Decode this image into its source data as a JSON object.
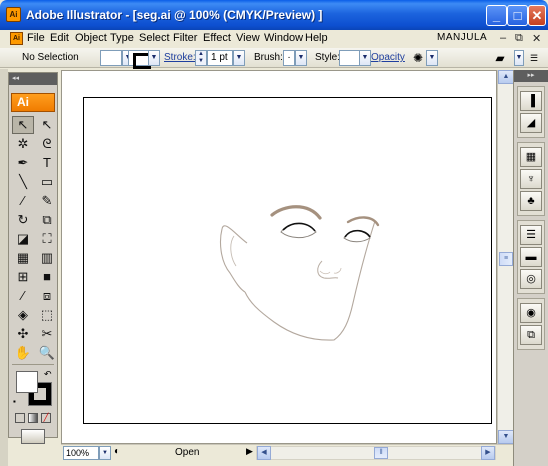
{
  "window": {
    "app_icon_text": "Ai",
    "title": "Adobe Illustrator - [seg.ai @ 100% (CMYK/Preview) ]",
    "minimize": "_",
    "maximize": "□",
    "close": "✕"
  },
  "menubar": {
    "doc_icon_text": "Ai",
    "items": [
      "File",
      "Edit",
      "Object",
      "Type",
      "Select",
      "Filter",
      "Effect",
      "View",
      "Window",
      "Help"
    ],
    "workspace": "MANJULA",
    "doc_minimize": "–",
    "doc_restore": "⧉",
    "doc_close": "✕"
  },
  "controlbar": {
    "selection": "No Selection",
    "stroke_label": "Stroke:",
    "stroke_weight": "1 pt",
    "brush_label": "Brush:",
    "brush_value": "·",
    "style_label": "Style:",
    "opacity_label": "Opacity"
  },
  "tools_panel": {
    "logo": "Ai",
    "collapse": "◂◂",
    "tools": [
      {
        "name": "selection-tool",
        "glyph": "↖"
      },
      {
        "name": "direct-selection-tool",
        "glyph": "↖"
      },
      {
        "name": "magic-wand-tool",
        "glyph": "✲"
      },
      {
        "name": "lasso-tool",
        "glyph": "ᘓ"
      },
      {
        "name": "pen-tool",
        "glyph": "✒"
      },
      {
        "name": "type-tool",
        "glyph": "T"
      },
      {
        "name": "line-segment-tool",
        "glyph": "╲"
      },
      {
        "name": "rectangle-tool",
        "glyph": "▭"
      },
      {
        "name": "paintbrush-tool",
        "glyph": "∕"
      },
      {
        "name": "pencil-tool",
        "glyph": "✎"
      },
      {
        "name": "rotate-tool",
        "glyph": "↻"
      },
      {
        "name": "scale-tool",
        "glyph": "⧉"
      },
      {
        "name": "warp-tool",
        "glyph": "◪"
      },
      {
        "name": "free-transform-tool",
        "glyph": "⛶"
      },
      {
        "name": "symbol-sprayer-tool",
        "glyph": "▦"
      },
      {
        "name": "column-graph-tool",
        "glyph": "▥"
      },
      {
        "name": "mesh-tool",
        "glyph": "⊞"
      },
      {
        "name": "gradient-tool",
        "glyph": "■"
      },
      {
        "name": "eyedropper-tool",
        "glyph": "⁄"
      },
      {
        "name": "blend-tool",
        "glyph": "⧈"
      },
      {
        "name": "live-paint-bucket-tool",
        "glyph": "◈"
      },
      {
        "name": "live-paint-selection-tool",
        "glyph": "⬚"
      },
      {
        "name": "slice-tool",
        "glyph": "✣"
      },
      {
        "name": "scissors-tool",
        "glyph": "✂"
      },
      {
        "name": "hand-tool",
        "glyph": "✋"
      },
      {
        "name": "zoom-tool",
        "glyph": "🔍"
      }
    ],
    "swap": "↶",
    "default_colors": "▪"
  },
  "statusbar": {
    "zoom": "100%",
    "status": "Open"
  },
  "dock": {
    "collapse": "▸▸",
    "groups": [
      [
        "color-panel-icon",
        "color-guide-icon"
      ],
      [
        "swatches-panel-icon",
        "brushes-panel-icon",
        "symbols-panel-icon"
      ],
      [
        "stroke-panel-icon",
        "gradient-panel-icon",
        "transparency-panel-icon"
      ],
      [
        "appearance-panel-icon",
        "layers-panel-icon"
      ]
    ],
    "glyphs": {
      "color-panel-icon": "▐",
      "color-guide-icon": "◢",
      "swatches-panel-icon": "▦",
      "brushes-panel-icon": "♆",
      "symbols-panel-icon": "♣",
      "stroke-panel-icon": "☰",
      "gradient-panel-icon": "▬",
      "transparency-panel-icon": "◎",
      "appearance-panel-icon": "◉",
      "layers-panel-icon": "⧉"
    }
  },
  "colors": {
    "accent": "#0a5ee8",
    "logo_orange": "#f07c00",
    "eyebrow": "#a5917f",
    "face_stroke": "#b3a89e"
  }
}
